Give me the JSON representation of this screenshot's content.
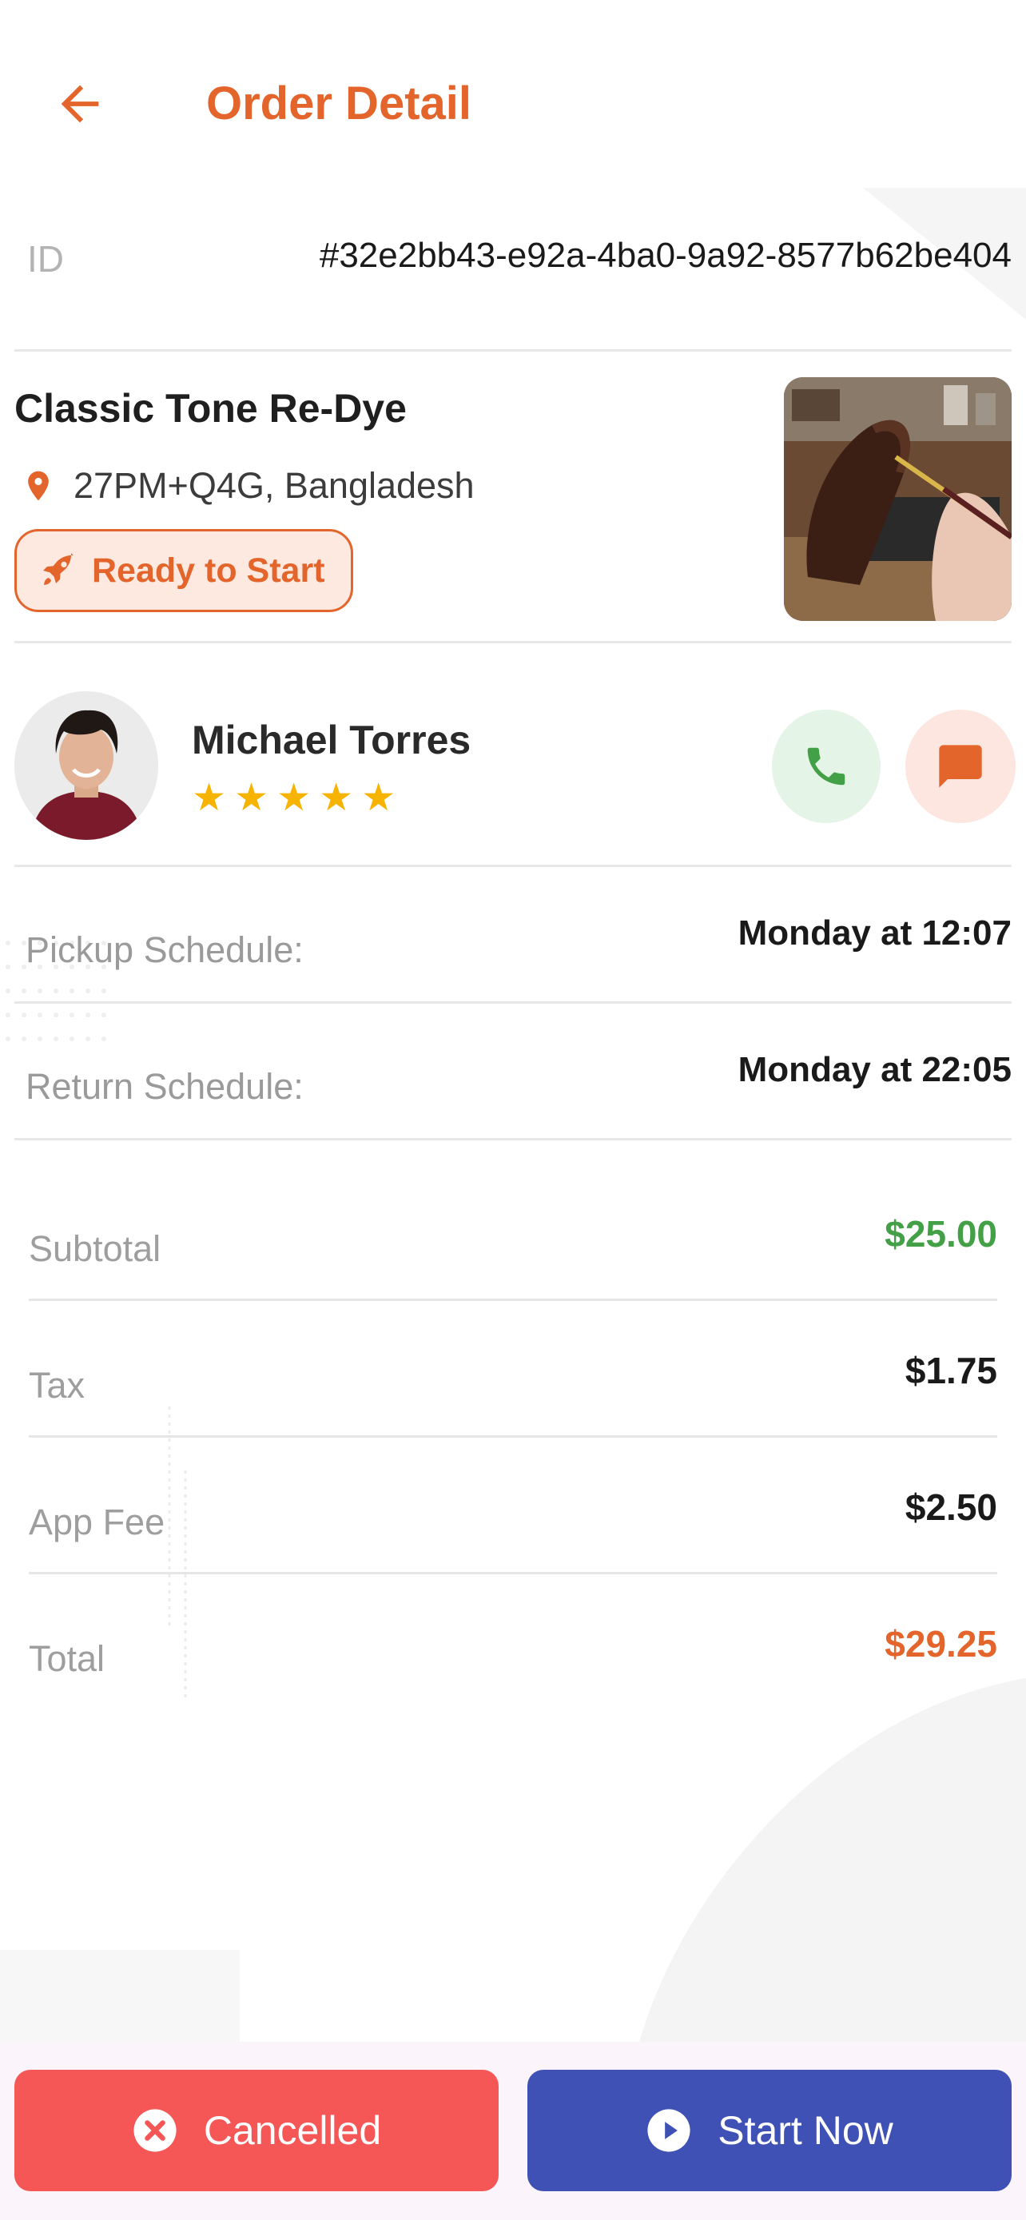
{
  "colors": {
    "accent": "#e4652c",
    "success": "#43a047",
    "danger": "#f55656",
    "primary": "#3f51b5",
    "star": "#f6b300"
  },
  "header": {
    "title": "Order Detail",
    "back_icon": "arrow-left-icon"
  },
  "order": {
    "id_label": "ID",
    "id_value": "#32e2bb43-e92a-4ba0-9a92-8577b62be404"
  },
  "service": {
    "name": "Classic Tone Re-Dye",
    "location_icon": "map-pin-icon",
    "location": "27PM+Q4G, Bangladesh",
    "status_icon": "rocket-icon",
    "status": "Ready to Start",
    "thumbnail": "boot-dyeing-photo"
  },
  "customer": {
    "name": "Michael Torres",
    "rating": 5,
    "rating_max": 5,
    "stars": [
      "★",
      "★",
      "★",
      "★",
      "★"
    ],
    "call_icon": "phone-icon",
    "message_icon": "chat-icon"
  },
  "schedule": {
    "pickup_label": "Pickup Schedule:",
    "pickup_value": "Monday at 12:07",
    "return_label": "Return Schedule:",
    "return_value": "Monday at 22:05"
  },
  "pricing": {
    "subtotal_label": "Subtotal",
    "subtotal_value": "$25.00",
    "tax_label": "Tax",
    "tax_value": "$1.75",
    "fee_label": "App Fee",
    "fee_value": "$2.50",
    "total_label": "Total",
    "total_value": "$29.25"
  },
  "actions": {
    "cancel_label": "Cancelled",
    "cancel_icon": "x-circle-icon",
    "start_label": "Start Now",
    "start_icon": "play-circle-icon"
  }
}
